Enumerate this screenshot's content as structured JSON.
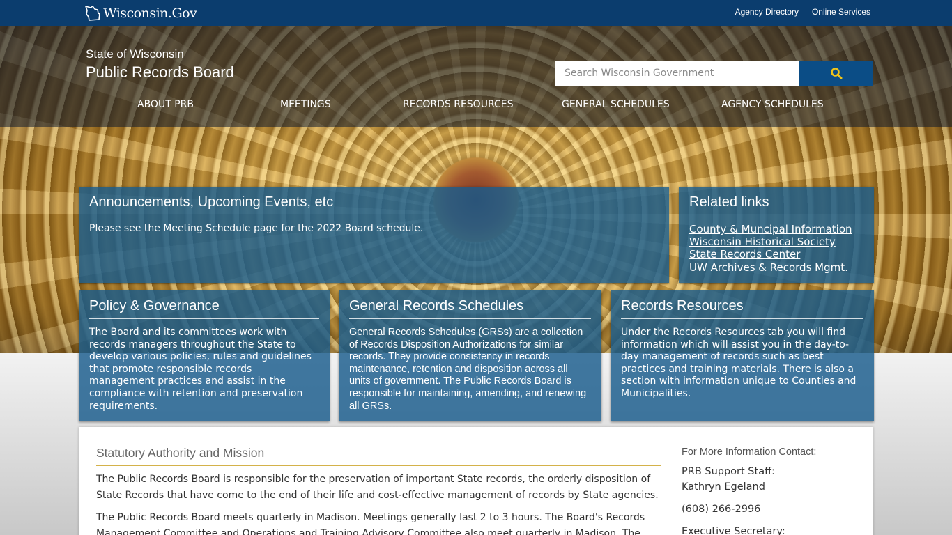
{
  "topbar": {
    "logo_text": "Wisconsin.Gov",
    "links": [
      "Agency Directory",
      "Online Services"
    ]
  },
  "site": {
    "subtitle": "State of Wisconsin",
    "title": "Public Records Board"
  },
  "search": {
    "placeholder": "Search Wisconsin Government",
    "icon": "search-icon"
  },
  "nav": [
    "ABOUT PRB",
    "MEETINGS",
    "RECORDS RESOURCES",
    "GENERAL SCHEDULES",
    "AGENCY SCHEDULES"
  ],
  "announcements": {
    "title": "Announcements, Upcoming Events, etc",
    "text": "Please see the Meeting Schedule page for the 2022 Board schedule."
  },
  "related": {
    "title": "Related links",
    "links": [
      "County & Muncipal Information",
      "Wisconsin Historical Society",
      "State Records Center",
      "UW Archives & Records Mgmt"
    ],
    "trailing": "."
  },
  "cards": [
    {
      "title": "Policy & Governance",
      "text": "The Board and its committees work with records managers throughout the State to develop various policies, rules and guidelines that promote responsible records management practices and assist in the compliance with retention and preservation requirements."
    },
    {
      "title": "General Records Schedules",
      "text": "General Records Schedules (GRSs) are a collection of Records Disposition Authorizations for similar records. They provide consistency in records maintenance, retention and disposition across all units of government. The Public Records Board is responsible for maintaining, amending, and renewing all GRSs."
    },
    {
      "title": "Records Resources",
      "text": "Under the Records Resources tab you will find information which will assist you in the day-to-day management of records such as best practices and training materials. There is also a section with information unique to Counties and Municipalities."
    }
  ],
  "content": {
    "title": "Statutory Authority and Mission",
    "para1": "The Public Records Board is responsible for the preservation of important State records, the orderly disposition of State Records that have come to the end of their life and cost-effective management of records by State agencies.",
    "para2": "The Public Records Board meets quarterly in Madison.  Meetings generally last 2 to 3 hours.  The Board's Records Management Committee and Operations and Training Advisory Committee also meet quarterly in Madison.  The"
  },
  "contact": {
    "label": "For More Information Contact:",
    "staff_label": "PRB Support Staff:",
    "staff_name": "Kathryn Egeland",
    "phone": "(608) 266-2996",
    "exec_label": "Executive Secretary:"
  },
  "colors": {
    "topbar": "#0b3d6e",
    "panel": "#185c8c",
    "search_button": "#0b4d86",
    "search_icon": "#f0c419"
  }
}
